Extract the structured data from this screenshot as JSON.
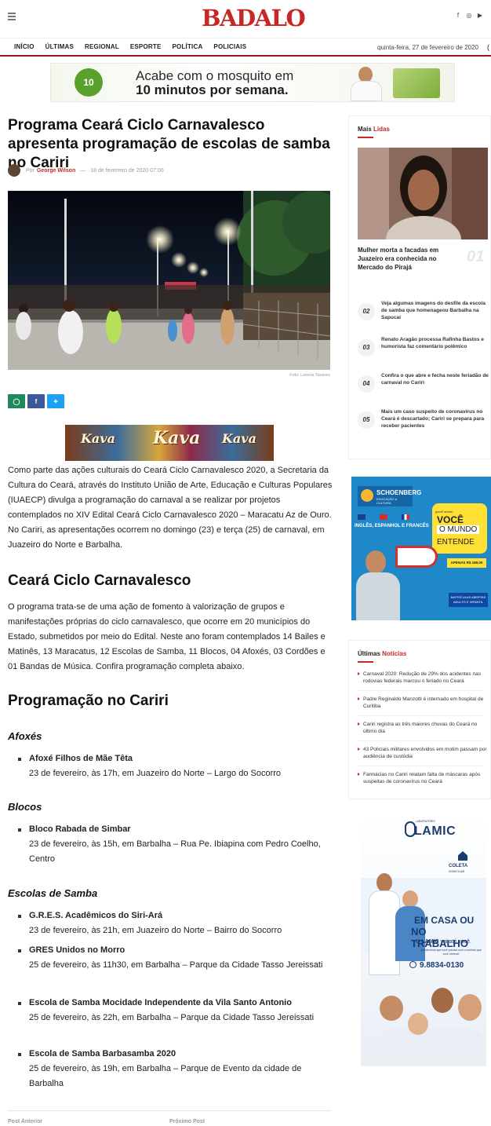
{
  "header": {
    "logo": "BADALO",
    "social_icons": [
      "facebook-icon",
      "instagram-icon",
      "youtube-icon"
    ]
  },
  "nav": {
    "items": [
      "INÍCIO",
      "ÚLTIMAS",
      "REGIONAL",
      "ESPORTE",
      "POLÍTICA",
      "POLICIAIS"
    ],
    "date": "quinta-feira, 27 de fevereiro de 2020"
  },
  "banner": {
    "line1": "Acabe com o mosquito em",
    "line2": "10 minutos por semana.",
    "badge": "10"
  },
  "article": {
    "title": "Programa Ceará Ciclo Carnavalesco apresenta programação de escolas de samba no Cariri",
    "by": "Por",
    "author": "George Wilson",
    "sep": "—",
    "date": "18 de fevereiro de 2020 07:00",
    "photo_credit": "Foto: Lorena Tavares",
    "kava_text": "Kava",
    "intro": "Como parte das ações culturais do Ceará Ciclo Carnavalesco 2020, a Secretaria da Cultura do Ceará, através do Instituto União de Arte, Educação e Culturas Populares (IUAECP) divulga a programação do carnaval a se realizar por projetos contemplados no XIV Edital Ceará Ciclo Carnavalesco 2020 – Maracatu Az de Ouro. No Cariri, as apresentações ocorrem no domingo (23) e terça (25) de carnaval, em Juazeiro do Norte e Barbalha.",
    "h2_1": "Ceará Ciclo Carnavalesco",
    "p2": "O programa trata-se de uma ação de fomento à valorização de grupos e manifestações próprias do ciclo carnavalesco, que ocorre em 20 municípios do Estado, submetidos por meio do Edital. Neste ano foram contemplados 14 Bailes e Matinês, 13 Maracatus, 12 Escolas de Samba, 11 Blocos, 04 Afoxés, 03 Cordões e 01 Bandas de Música. Confira programação completa abaixo.",
    "h2_2": "Programação no Cariri",
    "sections": [
      {
        "heading": "Afoxés",
        "events": [
          {
            "name": "Afoxé Filhos de Mãe Têta",
            "detail": "23 de fevereiro, às 17h, em Juazeiro do Norte – Largo do Socorro"
          }
        ]
      },
      {
        "heading": "Blocos",
        "events": [
          {
            "name": "Bloco Rabada de Simbar",
            "detail": "23 de fevereiro, às 15h, em Barbalha – Rua Pe. Ibiapina com Pedro Coelho, Centro"
          }
        ]
      },
      {
        "heading": "Escolas de Samba",
        "events": [
          {
            "name": "G.R.E.S. Acadêmicos do Siri-Ará",
            "detail": "23 de fevereiro, às 21h, em Juazeiro do Norte – Bairro do Socorro"
          },
          {
            "name": "GRES Unidos no Morro",
            "detail": "25 de fevereiro, às 11h30, em Barbalha – Parque da Cidade Tasso Jereissati"
          },
          {
            "name": "Escola de Samba Mocidade Independente da Vila Santo Antonio",
            "detail": "25 de fevereiro, às 22h, em Barbalha – Parque da Cidade Tasso Jereissati"
          },
          {
            "name": "Escola de Samba Barbasamba 2020",
            "detail": "25 de fevereiro, às 19h, em Barbalha – Parque de Evento da cidade de Barbalha"
          }
        ]
      }
    ],
    "prev_post": "Post Anterior",
    "next_post": "Próximo Post"
  },
  "sidebar": {
    "most_read": {
      "title_a": "Mais",
      "title_b": "Lidas",
      "featured_title": "Mulher morta a facadas em Juazeiro era conhecida no Mercado do Pirajá",
      "featured_num": "01",
      "items": [
        {
          "num": "02",
          "text": "Veja algumas imagens do desfile da escola de samba que homenageou Barbalha na Sapucaí"
        },
        {
          "num": "03",
          "text": "Renato Aragão processa Rafinha Bastos e humorista faz comentário polêmico"
        },
        {
          "num": "04",
          "text": "Confira o que abre e fecha neste feriadão de carnaval no Cariri"
        },
        {
          "num": "05",
          "text": "Mais um caso suspeito de coronavírus no Ceará é descartado; Cariri se prepara para receber pacientes"
        }
      ]
    },
    "school_ad": {
      "brand": "SCHOENBERG",
      "brand_sub": "EDUCAÇÃO & CULTURA",
      "langs": "INGLÊS, ESPANHOL E FRANCÊS",
      "bubble1": "good! ahora!",
      "bubble2": "VOCÊ FALA",
      "bubble3": "O MUNDO",
      "bubble4": "ENTENDE",
      "price": "APENAS R$ 189,00",
      "matri": "MATRÍCULAS ABERTAS ADULTO E INFANTIL"
    },
    "latest": {
      "title_a": "Últimas",
      "title_b": "Notícias",
      "items": [
        "Carnaval 2020: Redução de 29% dos acidentes nas rodovias federais marcou o feriado no Ceará",
        "Padre Reginaldo Manzotti é internado em hospital de Curitiba",
        "Cariri registra as três maiores chuvas do Ceará no último dia",
        "43 Policiais militares envolvidos em motim passam por audiência de custódia",
        "Farmácias no Cariri relatam falta de máscaras após suspeitas de coronavírus no Ceará"
      ]
    },
    "lamic_ad": {
      "sub": "LABORATÓRIO",
      "brand": "LAMIC",
      "coleta": "COLETA",
      "coleta_sub": "DOMICILIAR",
      "em": "EM CASA OU",
      "em2": "NO TRABALHO",
      "vai_a": "O",
      "vai_b": "LAMIC",
      "vai_c": "vai até você.",
      "small": "Atendimento que você precisa com o conforto que você merece!",
      "phone": "9.8834-0130"
    }
  }
}
